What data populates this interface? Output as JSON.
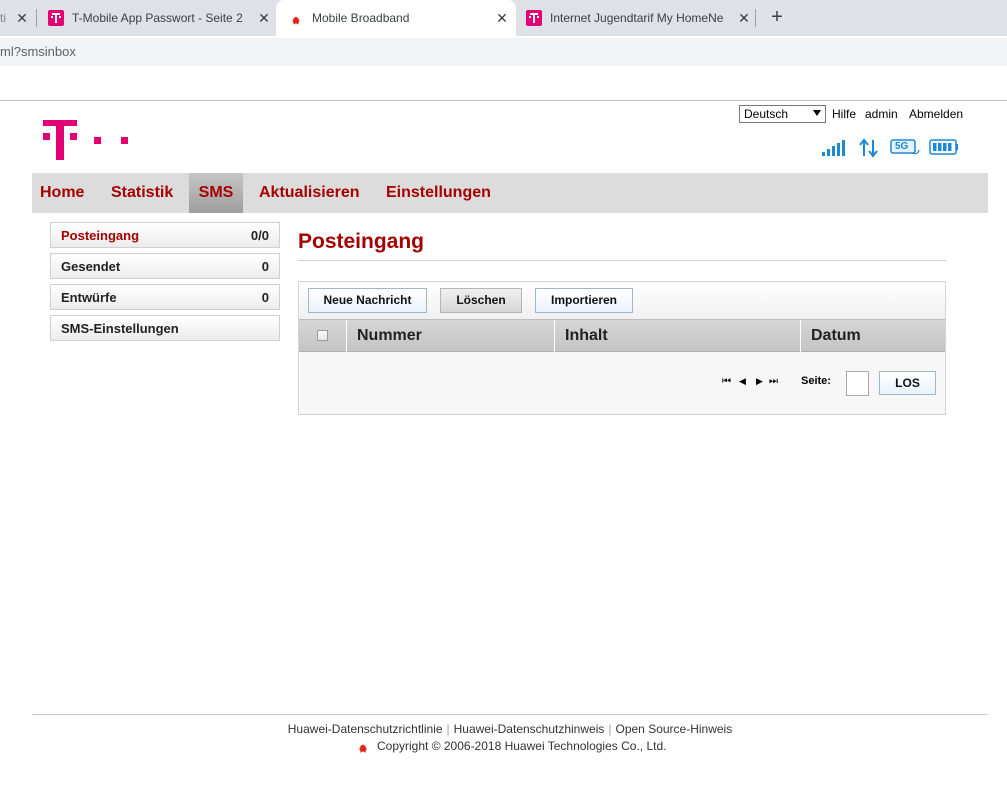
{
  "browser": {
    "tabs": [
      {
        "title": "ti",
        "favicon": "partial-tab"
      },
      {
        "title": "T-Mobile App Passwort - Seite 2",
        "favicon": "telekom-logo"
      },
      {
        "title": "Mobile Broadband",
        "favicon": "huawei-logo",
        "active": true
      },
      {
        "title": "Internet Jugendtarif My HomeNe",
        "favicon": "telekom-logo"
      }
    ],
    "close_glyph": "✕",
    "new_tab_glyph": "+",
    "url_fragment": "ml?smsinbox"
  },
  "header": {
    "language": "Deutsch",
    "help_label": "Hilfe",
    "user_label": "admin",
    "logout_label": "Abmelden",
    "network_badge": "5G",
    "brand_color": "#e20074"
  },
  "nav": {
    "items": [
      "Home",
      "Statistik",
      "SMS",
      "Aktualisieren",
      "Einstellungen"
    ],
    "active": "SMS"
  },
  "sidebar": {
    "items": [
      {
        "label": "Posteingang",
        "count": "0/0",
        "active": true
      },
      {
        "label": "Gesendet",
        "count": "0"
      },
      {
        "label": "Entwürfe",
        "count": "0"
      },
      {
        "label": "SMS-Einstellungen",
        "count": ""
      }
    ]
  },
  "main": {
    "title": "Posteingang",
    "buttons": {
      "new_message": "Neue Nachricht",
      "delete": "Löschen",
      "import": "Importieren"
    },
    "columns": [
      "Nummer",
      "Inhalt",
      "Datum"
    ],
    "pager": {
      "label": "Seite:",
      "go_label": "LOS",
      "first_glyph": "⏮",
      "prev_glyph": "◀",
      "next_glyph": "▶",
      "last_glyph": "⏭"
    }
  },
  "footer": {
    "links": [
      "Huawei-Datenschutzrichtlinie",
      "Huawei-Datenschutzhinweis",
      "Open Source-Hinweis"
    ],
    "copyright": "Copyright © 2006-2018 Huawei Technologies Co., Ltd."
  }
}
